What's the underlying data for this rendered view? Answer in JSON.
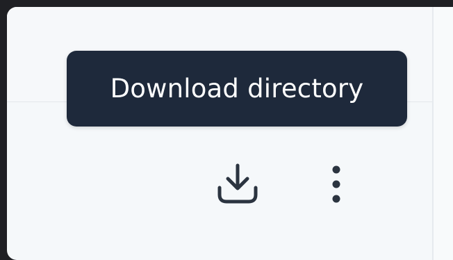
{
  "tooltip": {
    "text": "Download directory"
  },
  "toolbar": {
    "download_icon": "download-icon",
    "more_icon": "more-vertical-icon"
  },
  "colors": {
    "tooltip_bg": "#1e293b",
    "tooltip_text": "#ffffff",
    "icon": "#2b3440",
    "panel_bg": "#f5f8fa",
    "outer_bg": "#1f2024"
  }
}
